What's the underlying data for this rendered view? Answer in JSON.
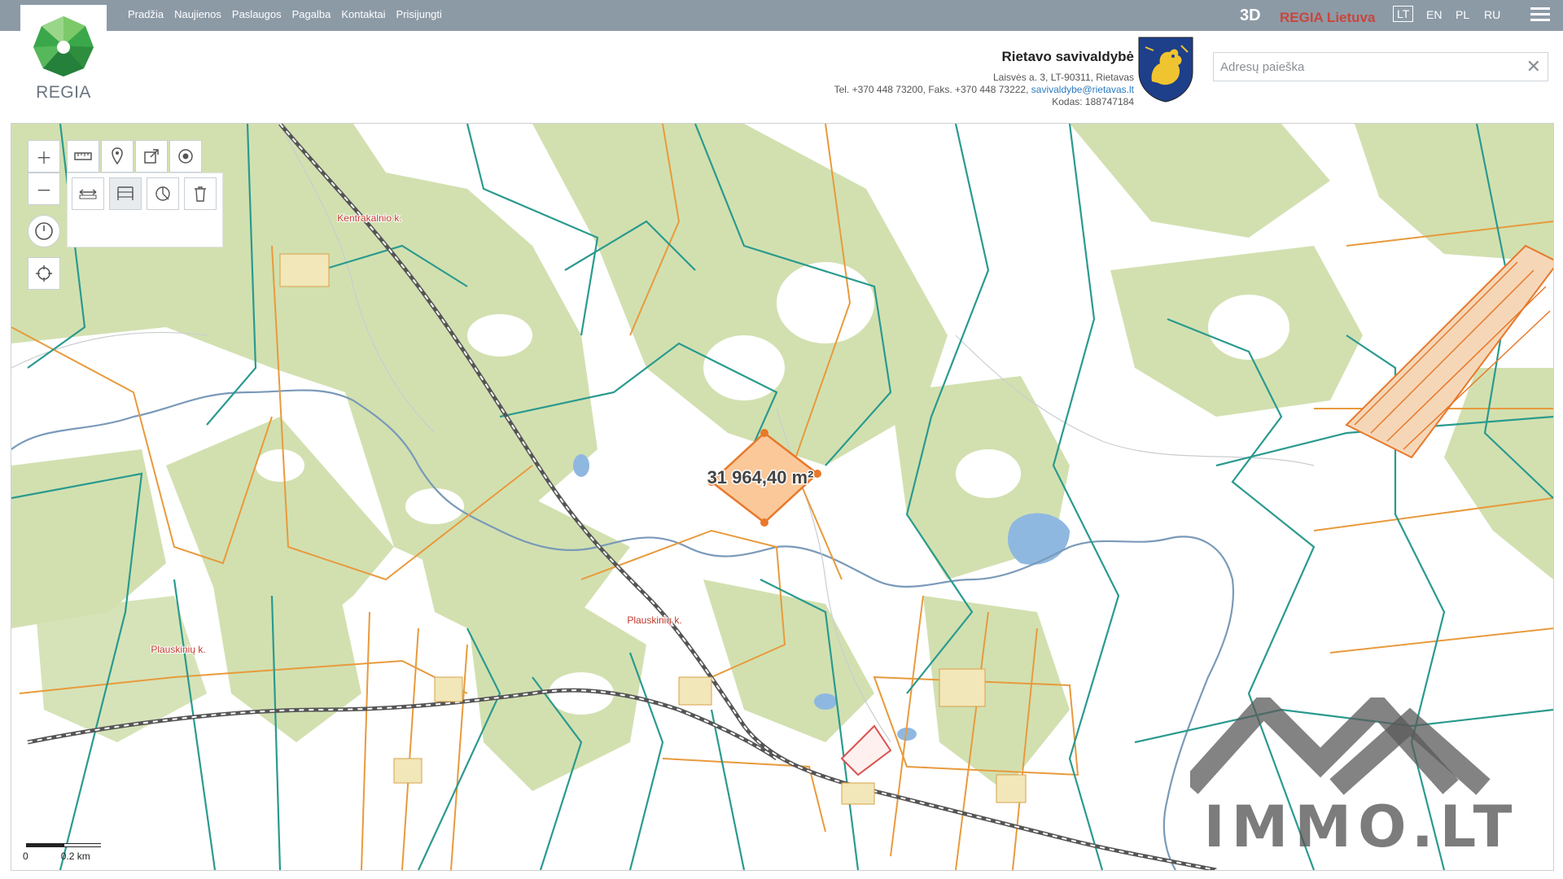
{
  "brand": {
    "logo_text": "REGIA"
  },
  "nav": [
    "Pradžia",
    "Naujienos",
    "Paslaugos",
    "Pagalba",
    "Kontaktai",
    "Prisijungti"
  ],
  "topbar": {
    "btn_3d": "3D",
    "regia_lietuva": "REGIA Lietuva",
    "languages": [
      "LT",
      "EN",
      "PL",
      "RU"
    ],
    "active_language": "LT",
    "menu_icon": "hamburger-icon"
  },
  "municipality": {
    "name": "Rietavo savivaldybė",
    "address": "Laisvės a. 3, LT-90311, Rietavas",
    "phone_prefix": "Tel. +370 448 73200, Faks. +370 448 73222, ",
    "email": "savivaldybe@rietavas.lt",
    "code": "Kodas: 188747184"
  },
  "search": {
    "placeholder": "Adresų paieška",
    "value": ""
  },
  "map": {
    "area_label": "31 964,40 m²",
    "villages": [
      "Kentrakalnio k.",
      "Plauskinių k.",
      "Plauskinių k."
    ],
    "scale_zero": "0",
    "scale_label": "0.2 km",
    "colors": {
      "forest": "#d2e0b0",
      "parcel_teal": "#2a9a8e",
      "parcel_orange": "#e89a3c",
      "selected_fill": "#fbc89a",
      "selected_stroke": "#e8782a",
      "water": "#8fb8e0",
      "railway": "#555555"
    }
  },
  "tools": {
    "zoom_in": "zoom-in-icon",
    "zoom_out": "zoom-out-icon",
    "measure": "ruler-icon",
    "marker": "map-pin-icon",
    "share": "share-icon",
    "target": "target-icon",
    "history": "history-icon",
    "locate": "locate-icon",
    "sub": [
      "measure-distance-icon",
      "measure-area-icon",
      "measure-angle-icon",
      "trash-icon"
    ]
  },
  "watermark": {
    "text": "IMMO.LT"
  }
}
